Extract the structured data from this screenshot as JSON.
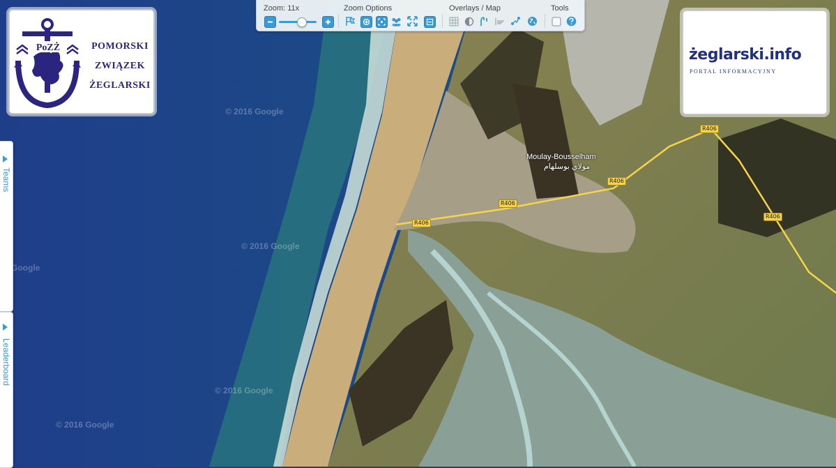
{
  "logos": {
    "pozz": {
      "initials": "PoZŻ",
      "lines": [
        "POMORSKI",
        "ZWIĄZEK",
        "ŻEGLARSKI"
      ]
    },
    "zeglarski": {
      "title": "żeglarski.info",
      "subtitle": "PORTAL INFORMACYJNY"
    }
  },
  "toolbar": {
    "zoom_label": "Zoom: 11x",
    "zoom_options_label": "Zoom Options",
    "overlays_label": "Overlays / Map",
    "tools_label": "Tools",
    "zoom_level": 11
  },
  "side_tabs": {
    "teams": "Teams",
    "leaderboard": "Leaderboard"
  },
  "map": {
    "place_label": "Moulay-Bousselham",
    "place_label_ar": "مولاي بوسلهام",
    "roads": [
      "R406",
      "R406",
      "R406",
      "R406",
      "R406"
    ],
    "watermarks": [
      "© 2016 Google",
      "© 2016 Google",
      "© 2016 Google",
      "© 2016 Google",
      "Google"
    ]
  },
  "colors": {
    "accent": "#3a9ad3",
    "brand_navy": "#2c2580",
    "ocean": "#1e3f86",
    "road": "#f6d44a"
  }
}
